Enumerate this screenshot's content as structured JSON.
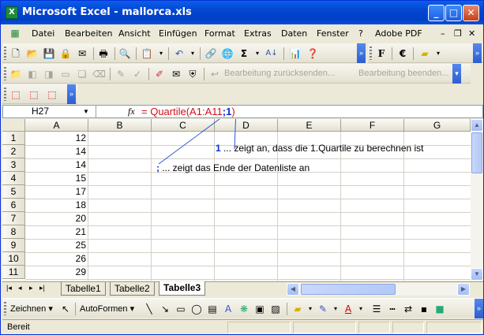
{
  "window": {
    "title": "Microsoft Excel - mallorca.xls",
    "app_icon": "X"
  },
  "titlebar_buttons": {
    "minimize": "_",
    "maximize": "□",
    "close": "✕"
  },
  "menu": [
    "Datei",
    "Bearbeiten",
    "Ansicht",
    "Einfügen",
    "Format",
    "Extras",
    "Daten",
    "Fenster",
    "?",
    "Adobe PDF"
  ],
  "doc_controls": {
    "minimize": "–",
    "restore": "❐",
    "close": "✕"
  },
  "toolbar": {
    "sum": "Σ",
    "bold": "F",
    "euro": "€",
    "review_send": "Bearbeitung zurücksenden...",
    "review_end": "Bearbeitung beenden..."
  },
  "formula_bar": {
    "name_box": "H27",
    "fx": "fx",
    "formula_prefix": "= Quartile(A1:A11",
    "formula_sep": ";",
    "formula_arg": "1",
    "formula_close": ")"
  },
  "columns": [
    "A",
    "B",
    "C",
    "D",
    "E",
    "F",
    "G"
  ],
  "rows": [
    {
      "n": "1",
      "a": "12"
    },
    {
      "n": "2",
      "a": "14"
    },
    {
      "n": "3",
      "a": "14"
    },
    {
      "n": "4",
      "a": "15"
    },
    {
      "n": "5",
      "a": "17"
    },
    {
      "n": "6",
      "a": "18"
    },
    {
      "n": "7",
      "a": "20"
    },
    {
      "n": "8",
      "a": "21"
    },
    {
      "n": "9",
      "a": "25"
    },
    {
      "n": "10",
      "a": "26"
    },
    {
      "n": "11",
      "a": "29"
    }
  ],
  "annotations": {
    "arg_marker": "1",
    "arg_text": " ... zeigt an, dass die 1.Quartile zu berechnen ist",
    "sep_marker": ";",
    "sep_text": " ... zeigt das Ende der Datenliste an"
  },
  "sheets": {
    "tab1": "Tabelle1",
    "tab2": "Tabelle2",
    "tab3": "Tabelle3",
    "active": "Tabelle3"
  },
  "drawing": {
    "zeichnen": "Zeichnen",
    "autoformen": "AutoFormen"
  },
  "status": "Bereit",
  "colors": {
    "formula_text": "#d0101a",
    "highlight": "#0a2fd0",
    "titlebar": "#0446d3"
  }
}
